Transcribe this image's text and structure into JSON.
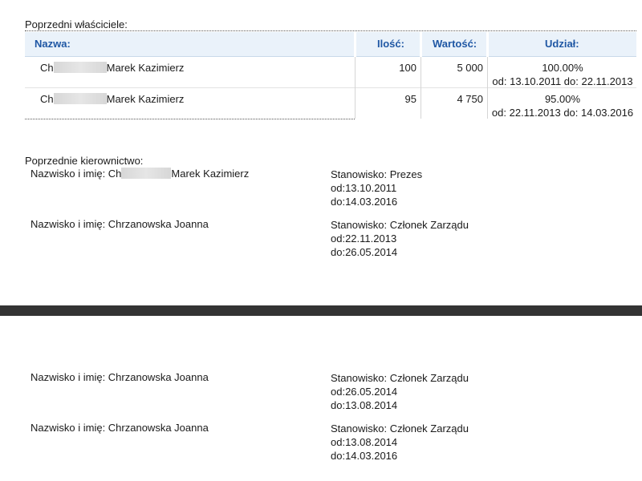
{
  "owners": {
    "title": "Poprzedni właściciele:",
    "headers": {
      "name": "Nazwa:",
      "quantity": "Ilość:",
      "value": "Wartość:",
      "share": "Udział:"
    },
    "rows": [
      {
        "name_prefix": "Ch",
        "name_suffix": "Marek Kazimierz",
        "quantity": "100",
        "value": "5 000",
        "share": "100.00%",
        "period": "od: 13.10.2011 do: 22.11.2013"
      },
      {
        "name_prefix": "Ch",
        "name_suffix": "Marek Kazimierz",
        "quantity": "95",
        "value": "4 750",
        "share": "95.00%",
        "period": "od: 22.11.2013 do: 14.03.2016"
      }
    ]
  },
  "management": {
    "title": "Poprzednie kierownictwo:",
    "entries": [
      {
        "name_prefix": "Nazwisko i imię: Ch",
        "name_suffix": "Marek Kazimierz",
        "position": "Stanowisko: Prezes",
        "from": "od:13.10.2011",
        "to": "do:14.03.2016"
      },
      {
        "name": "Nazwisko i imię: Chrzanowska Joanna",
        "position": "Stanowisko: Członek Zarządu",
        "from": "od:22.11.2013",
        "to": "do:26.05.2014"
      },
      {
        "name": "Nazwisko i imię: Chrzanowska Joanna",
        "position": "Stanowisko: Członek Zarządu",
        "from": "od:26.05.2014",
        "to": "do:13.08.2014"
      },
      {
        "name": "Nazwisko i imię: Chrzanowska Joanna",
        "position": "Stanowisko: Członek Zarządu",
        "from": "od:13.08.2014",
        "to": "do:14.03.2016"
      }
    ]
  }
}
